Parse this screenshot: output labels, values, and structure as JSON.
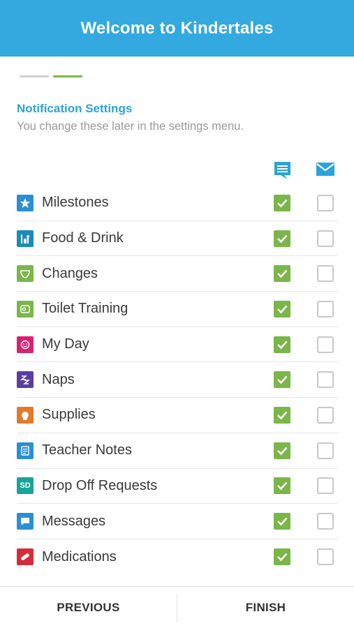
{
  "header": {
    "title": "Welcome to Kindertales"
  },
  "progress": {
    "steps": 2,
    "current": 2
  },
  "section": {
    "title": "Notification Settings",
    "subtitle": "You change these later in the settings menu."
  },
  "columns": [
    {
      "icon": "chat-bubble-icon",
      "color": "#2aa3dc"
    },
    {
      "icon": "envelope-icon",
      "color": "#2aa3dc"
    }
  ],
  "items": [
    {
      "label": "Milestones",
      "icon": "star-icon",
      "color": "#2a8fd4",
      "push": true,
      "email": false
    },
    {
      "label": "Food & Drink",
      "icon": "food-drink-icon",
      "color": "#1c8ab8",
      "push": true,
      "email": false
    },
    {
      "label": "Changes",
      "icon": "diaper-icon",
      "color": "#7ab648",
      "push": true,
      "email": false
    },
    {
      "label": "Toilet Training",
      "icon": "toilet-paper-icon",
      "color": "#7ab648",
      "push": true,
      "email": false
    },
    {
      "label": "My Day",
      "icon": "smiley-icon",
      "color": "#d8216f",
      "push": true,
      "email": false
    },
    {
      "label": "Naps",
      "icon": "sleep-icon",
      "color": "#5a3f9e",
      "push": true,
      "email": false
    },
    {
      "label": "Supplies",
      "icon": "supplies-icon",
      "color": "#e07b2e",
      "push": true,
      "email": false
    },
    {
      "label": "Teacher Notes",
      "icon": "notes-icon",
      "color": "#2a8fd4",
      "push": true,
      "email": false
    },
    {
      "label": "Drop Off Requests",
      "icon": "sd-badge-icon",
      "badge": "SD",
      "color": "#1aa39a",
      "push": true,
      "email": false
    },
    {
      "label": "Messages",
      "icon": "message-icon",
      "color": "#2a8fd4",
      "push": true,
      "email": false
    },
    {
      "label": "Medications",
      "icon": "pill-icon",
      "color": "#d62c3a",
      "push": true,
      "email": false
    }
  ],
  "footer": {
    "previous_label": "PREVIOUS",
    "finish_label": "FINISH"
  }
}
